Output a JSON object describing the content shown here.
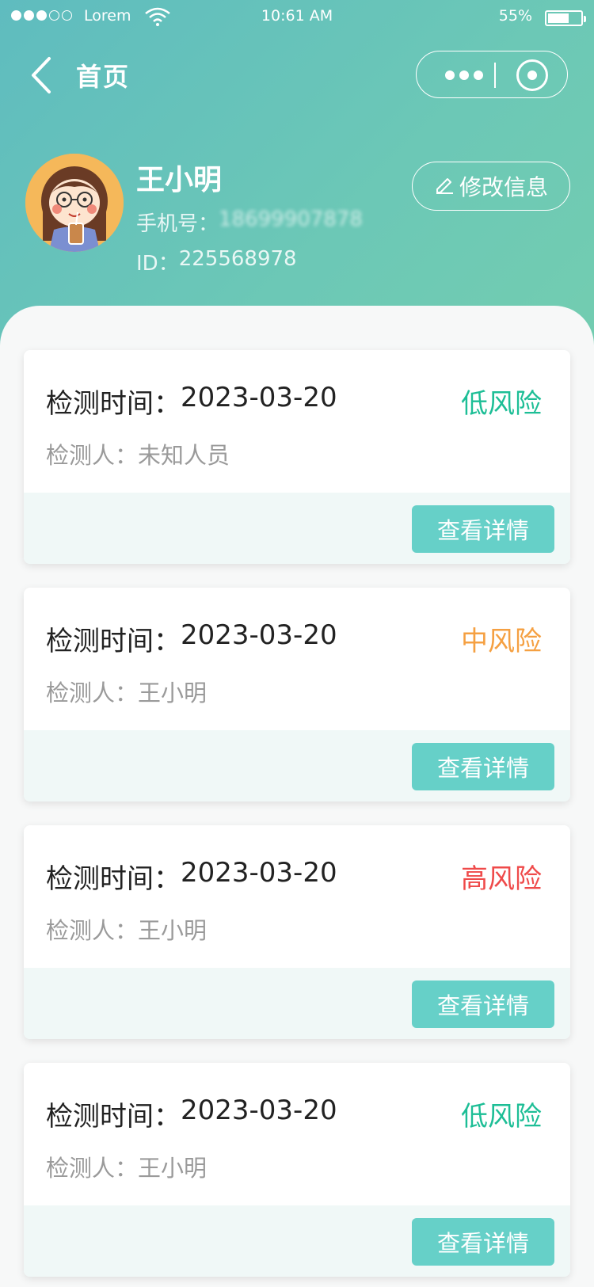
{
  "status_bar": {
    "carrier": "Lorem",
    "time": "10:61 AM",
    "battery": "55%",
    "battery_level": 0.55
  },
  "nav": {
    "title": "首页"
  },
  "profile": {
    "name": "王小明",
    "phone_label": "手机号：",
    "phone_value": "18699907878",
    "id_label": "ID：",
    "id_value": "225568978",
    "edit_label": "修改信息"
  },
  "records": [
    {
      "time_label": "检测时间：",
      "date": "2023-03-20",
      "risk": "低风险",
      "risk_color": "#1dbe96",
      "person_label": "检测人：",
      "person": "未知人员",
      "button": "查看详情"
    },
    {
      "time_label": "检测时间：",
      "date": "2023-03-20",
      "risk": "中风险",
      "risk_color": "#f5a042",
      "person_label": "检测人：",
      "person": "王小明",
      "button": "查看详情"
    },
    {
      "time_label": "检测时间：",
      "date": "2023-03-20",
      "risk": "高风险",
      "risk_color": "#ef4a4a",
      "person_label": "检测人：",
      "person": "王小明",
      "button": "查看详情"
    },
    {
      "time_label": "检测时间：",
      "date": "2023-03-20",
      "risk": "低风险",
      "risk_color": "#1dbe96",
      "person_label": "检测人：",
      "person": "王小明",
      "button": "查看详情"
    }
  ],
  "colors": {
    "header_gradient_start": "#5fbcbf",
    "header_gradient_end": "#73cdb0",
    "button": "#66d0c8",
    "card_footer": "#f0f8f7"
  },
  "icons": [
    "signal-dots-icon",
    "wifi-icon",
    "battery-icon",
    "back-arrow-icon",
    "more-dots-icon",
    "target-icon",
    "edit-pen-icon"
  ]
}
